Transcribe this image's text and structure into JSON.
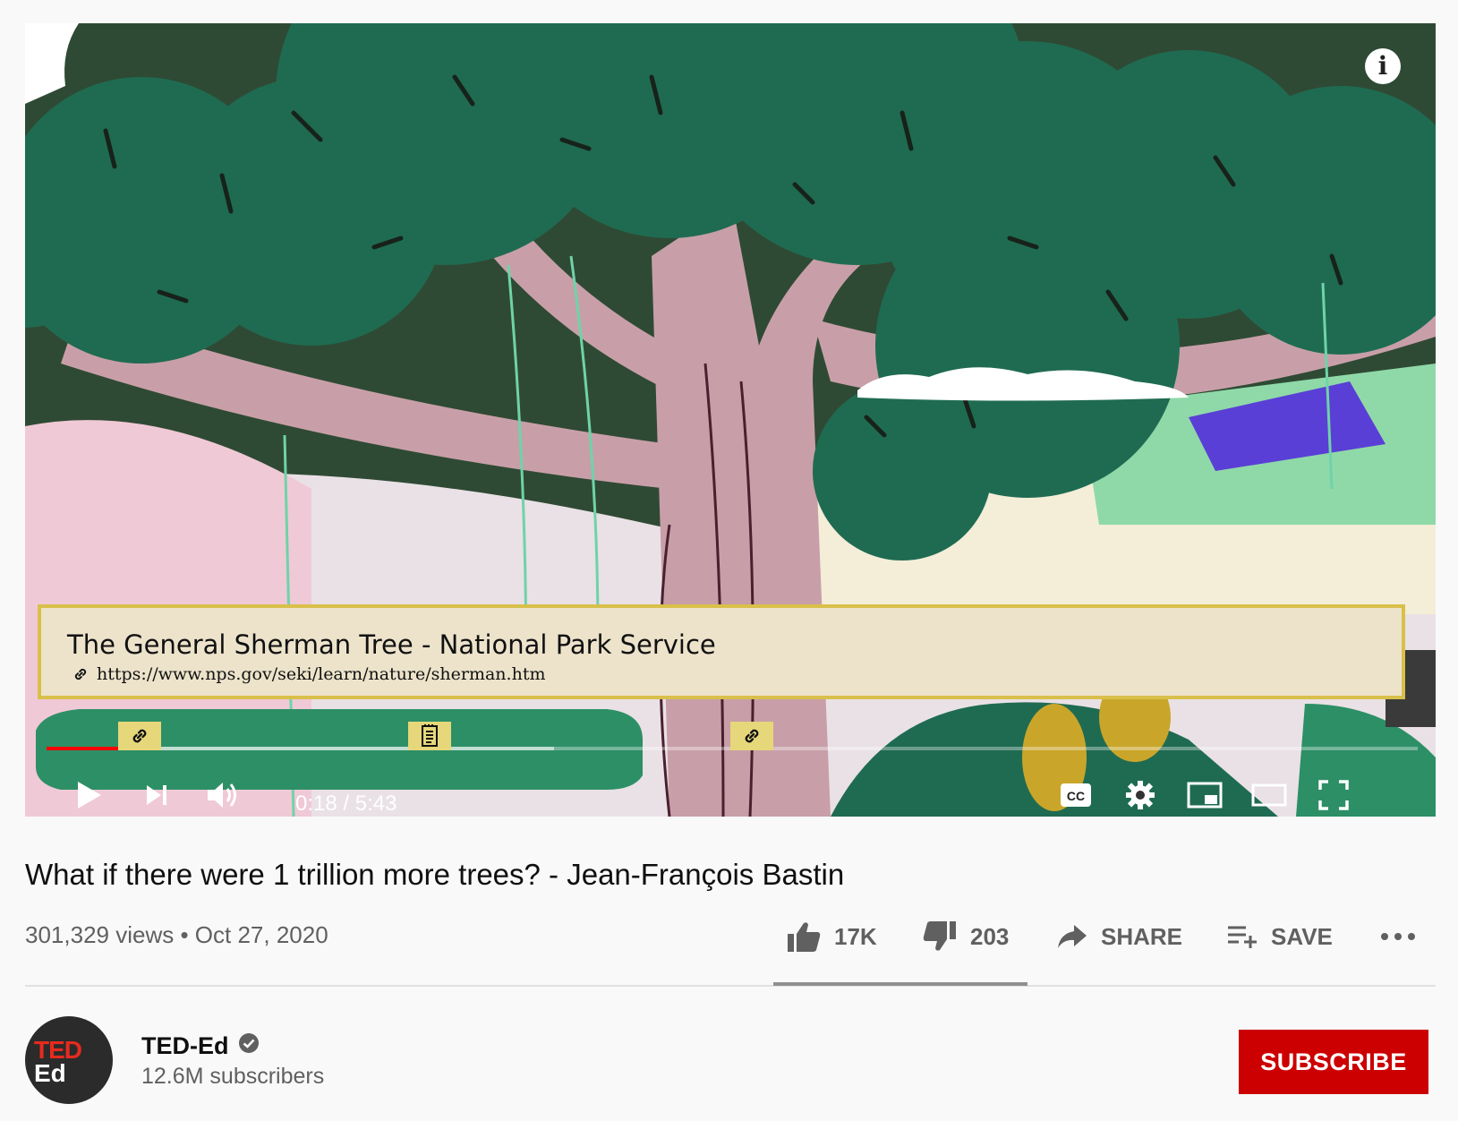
{
  "annotation": {
    "title": "The General Sherman Tree - National Park Service",
    "url": "https://www.nps.gov/seki/learn/nature/sherman.htm"
  },
  "player": {
    "time_display": "0:18 / 5:43",
    "played_fraction": 0.053,
    "loaded_fraction": 0.37,
    "markers": [
      "link-icon",
      "document-icon",
      "link-icon"
    ]
  },
  "video": {
    "title": "What if there were 1 trillion more trees? - Jean-François Bastin",
    "views": "301,329 views",
    "date": "Oct 27, 2020"
  },
  "actions": {
    "likes": "17K",
    "dislikes": "203",
    "share": "SHARE",
    "save": "SAVE"
  },
  "channel": {
    "name": "TED-Ed",
    "subscribers": "12.6M subscribers",
    "avatar_text_top": "TED",
    "avatar_text_bottom": "Ed",
    "subscribe_label": "SUBSCRIBE"
  },
  "colors": {
    "played": "#ff0000",
    "subscribe": "#cc0000",
    "annotation_bg": "#ede3cb",
    "annotation_border": "#d8c04a",
    "marker": "#e6d77a"
  }
}
